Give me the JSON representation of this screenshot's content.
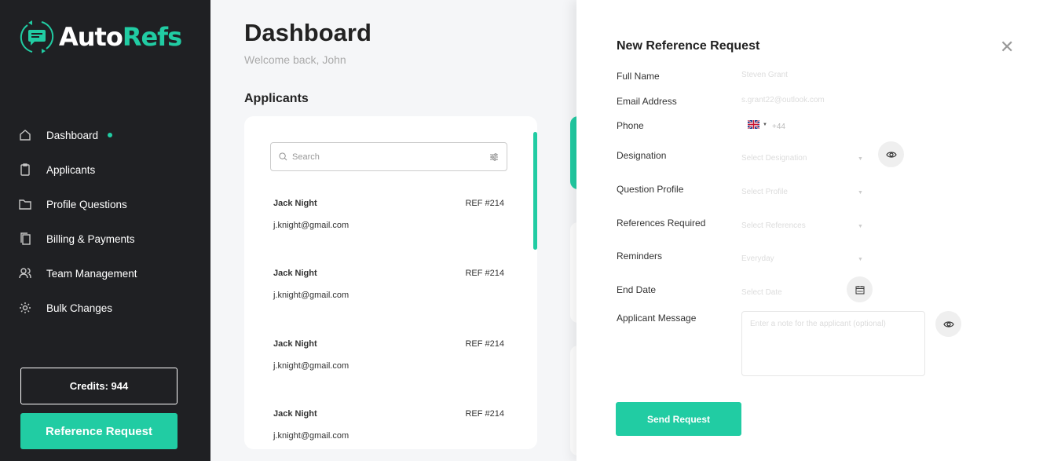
{
  "brand": {
    "name_a": "Auto",
    "name_b": "Refs",
    "accent": "#21cca3"
  },
  "sidebar": {
    "items": [
      {
        "label": "Dashboard",
        "icon": "home-icon",
        "active": true
      },
      {
        "label": "Applicants",
        "icon": "clipboard-icon"
      },
      {
        "label": "Profile Questions",
        "icon": "folder-icon"
      },
      {
        "label": "Billing & Payments",
        "icon": "copy-icon"
      },
      {
        "label": "Team Management",
        "icon": "users-icon"
      },
      {
        "label": "Bulk Changes",
        "icon": "gear-icon"
      }
    ],
    "credits": "Credits: 944",
    "reference_button": "Reference Request"
  },
  "header": {
    "title": "Dashboard",
    "welcome": "Welcome back, John"
  },
  "applicants": {
    "heading": "Applicants",
    "search_placeholder": "Search",
    "items": [
      {
        "name": "Jack Night",
        "ref": "REF #214",
        "email": "j.knight@gmail.com"
      },
      {
        "name": "Jack Night",
        "ref": "REF #214",
        "email": "j.knight@gmail.com"
      },
      {
        "name": "Jack Night",
        "ref": "REF #214",
        "email": "j.knight@gmail.com"
      },
      {
        "name": "Jack Night",
        "ref": "REF #214",
        "email": "j.knight@gmail.com"
      }
    ]
  },
  "form": {
    "title": "New Reference Request",
    "labels": {
      "full_name": "Full Name",
      "email": "Email Address",
      "phone": "Phone",
      "designation": "Designation",
      "question_profile": "Question Profile",
      "references": "References Required",
      "reminders": "Reminders",
      "end_date": "End Date",
      "message": "Applicant Message"
    },
    "values": {
      "full_name": "Steven Grant",
      "email": "s.grant22@outlook.com",
      "phone_code": "+44",
      "designation": "Select Designation",
      "question_profile": "Select Profile",
      "references": "Select References",
      "reminders": "Everyday",
      "end_date": "Select Date",
      "message_placeholder": "Enter a note for the applicant (optional)"
    },
    "send": "Send Request"
  }
}
